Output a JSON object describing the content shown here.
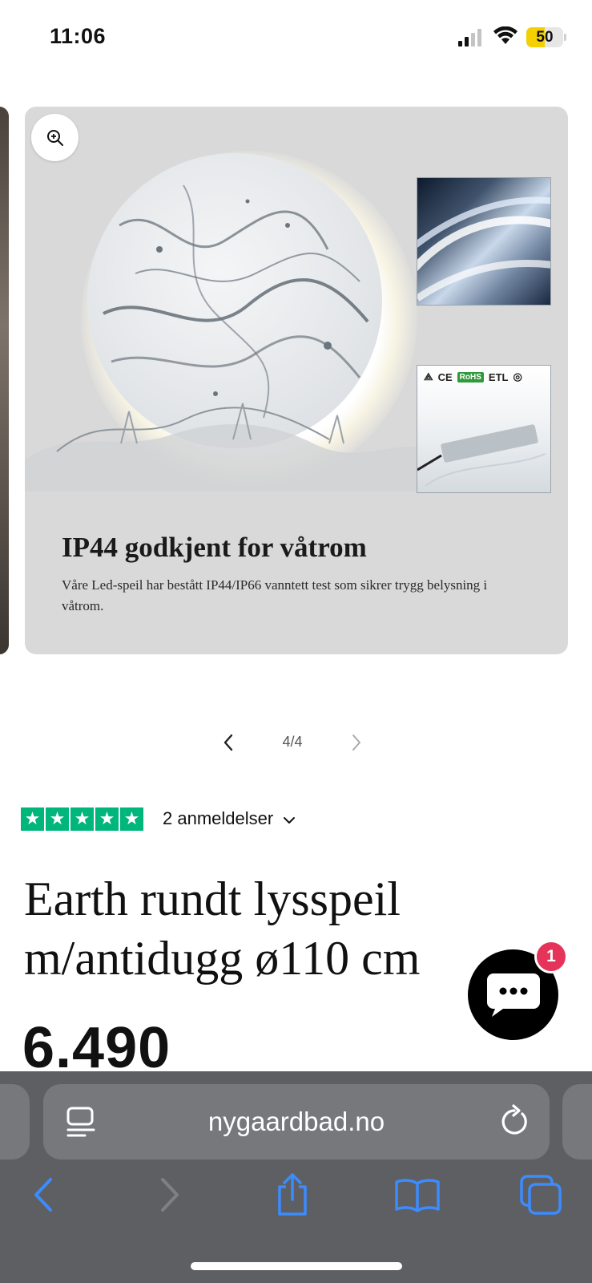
{
  "status_bar": {
    "time": "11:06",
    "battery": "50",
    "battery_fraction": 0.5,
    "battery_color": "#f5d000"
  },
  "slide": {
    "zoom_icon": "zoom-in-icon",
    "heading": "IP44 godkjent for våtrom",
    "body": "Våre Led-speil har bestått IP44/IP66 vanntett test som sikrer trygg belysning i våtrom.",
    "cert_marks": [
      "CE",
      "RoHS",
      "ETL"
    ]
  },
  "pager": {
    "count": "4/4",
    "prev_icon": "chevron-left-icon",
    "next_icon": "chevron-right-icon"
  },
  "reviews": {
    "stars": 5,
    "label": "2 anmeldelser",
    "star_color": "#00b67a"
  },
  "product": {
    "title": "Earth rundt lysspeil m/antidugg ø110 cm",
    "price": "6.490"
  },
  "chat": {
    "badge": "1",
    "badge_color": "#e5335a"
  },
  "browser": {
    "url": "nygaardbad.no",
    "accent": "#3b8cff"
  }
}
